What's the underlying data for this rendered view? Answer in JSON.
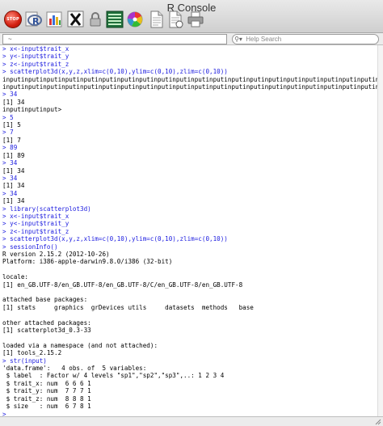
{
  "window": {
    "title": "R Console"
  },
  "toolbar": {
    "stop_label": "STOP",
    "buttons": [
      {
        "name": "stop-button",
        "icon": "stop-icon"
      },
      {
        "name": "r-source-button",
        "icon": "r-logo-icon"
      },
      {
        "name": "chart-button",
        "icon": "bar-chart-icon"
      },
      {
        "name": "x11-button",
        "icon": "x11-icon"
      },
      {
        "name": "lock-button",
        "icon": "lock-icon"
      },
      {
        "name": "list-button",
        "icon": "list-icon"
      },
      {
        "name": "color-button",
        "icon": "color-wheel-icon"
      },
      {
        "name": "new-document-button",
        "icon": "document-icon"
      },
      {
        "name": "open-document-button",
        "icon": "open-document-icon"
      },
      {
        "name": "print-button",
        "icon": "printer-icon"
      }
    ]
  },
  "path_field": {
    "value": "~"
  },
  "help_search": {
    "placeholder": "Help Search"
  },
  "console": {
    "lines": [
      {
        "t": "in",
        "text": "> x<-input$trait_x"
      },
      {
        "t": "in",
        "text": "> y<-input$trait_y"
      },
      {
        "t": "in",
        "text": "> z<-input$trait_z"
      },
      {
        "t": "in",
        "text": "> scatterplot3d(x,y,z,xlim=c(0,10),ylim=c(0,10),zlim=c(0,10))"
      },
      {
        "t": "out",
        "text": "inputinputinputinputinputinputinputinputinputinputinputinputinputinputinputinputinputinputinputinputinputinput"
      },
      {
        "t": "out",
        "text": "inputinputinputinputinputinputinputinputinputinputinputinputinputinputinputinputinputinputinputinputinputinput"
      },
      {
        "t": "in",
        "text": "> 34"
      },
      {
        "t": "out",
        "text": "[1] 34"
      },
      {
        "t": "out",
        "text": "inputinputinput>"
      },
      {
        "t": "in",
        "text": "> 5"
      },
      {
        "t": "out",
        "text": "[1] 5"
      },
      {
        "t": "in",
        "text": "> 7"
      },
      {
        "t": "out",
        "text": "[1] 7"
      },
      {
        "t": "in",
        "text": "> 89"
      },
      {
        "t": "out",
        "text": "[1] 89"
      },
      {
        "t": "in",
        "text": "> 34"
      },
      {
        "t": "out",
        "text": "[1] 34"
      },
      {
        "t": "in",
        "text": "> 34"
      },
      {
        "t": "out",
        "text": "[1] 34"
      },
      {
        "t": "in",
        "text": "> 34"
      },
      {
        "t": "out",
        "text": "[1] 34"
      },
      {
        "t": "in",
        "text": "> library(scatterplot3d)"
      },
      {
        "t": "in",
        "text": "> x<-input$trait_x"
      },
      {
        "t": "in",
        "text": "> y<-input$trait_y"
      },
      {
        "t": "in",
        "text": "> z<-input$trait_z"
      },
      {
        "t": "in",
        "text": "> scatterplot3d(x,y,z,xlim=c(0,10),ylim=c(0,10),zlim=c(0,10))"
      },
      {
        "t": "in",
        "text": "> sessionInfo()"
      },
      {
        "t": "out",
        "text": "R version 2.15.2 (2012-10-26)"
      },
      {
        "t": "out",
        "text": "Platform: i386-apple-darwin9.8.0/i386 (32-bit)"
      },
      {
        "t": "out",
        "text": ""
      },
      {
        "t": "out",
        "text": "locale:"
      },
      {
        "t": "out",
        "text": "[1] en_GB.UTF-8/en_GB.UTF-8/en_GB.UTF-8/C/en_GB.UTF-8/en_GB.UTF-8"
      },
      {
        "t": "out",
        "text": ""
      },
      {
        "t": "out",
        "text": "attached base packages:"
      },
      {
        "t": "out",
        "text": "[1] stats     graphics  grDevices utils     datasets  methods   base"
      },
      {
        "t": "out",
        "text": ""
      },
      {
        "t": "out",
        "text": "other attached packages:"
      },
      {
        "t": "out",
        "text": "[1] scatterplot3d_0.3-33"
      },
      {
        "t": "out",
        "text": ""
      },
      {
        "t": "out",
        "text": "loaded via a namespace (and not attached):"
      },
      {
        "t": "out",
        "text": "[1] tools_2.15.2"
      },
      {
        "t": "in",
        "text": "> str(input)"
      },
      {
        "t": "out",
        "text": "'data.frame':   4 obs. of  5 variables:"
      },
      {
        "t": "out",
        "text": " $ label  : Factor w/ 4 levels \"sp1\",\"sp2\",\"sp3\",..: 1 2 3 4"
      },
      {
        "t": "out",
        "text": " $ trait_x: num  6 6 6 1"
      },
      {
        "t": "out",
        "text": " $ trait_y: num  7 7 7 1"
      },
      {
        "t": "out",
        "text": " $ trait_z: num  8 8 8 1"
      },
      {
        "t": "out",
        "text": " $ size   : num  6 7 8 1"
      },
      {
        "t": "in",
        "text": ">"
      }
    ]
  }
}
